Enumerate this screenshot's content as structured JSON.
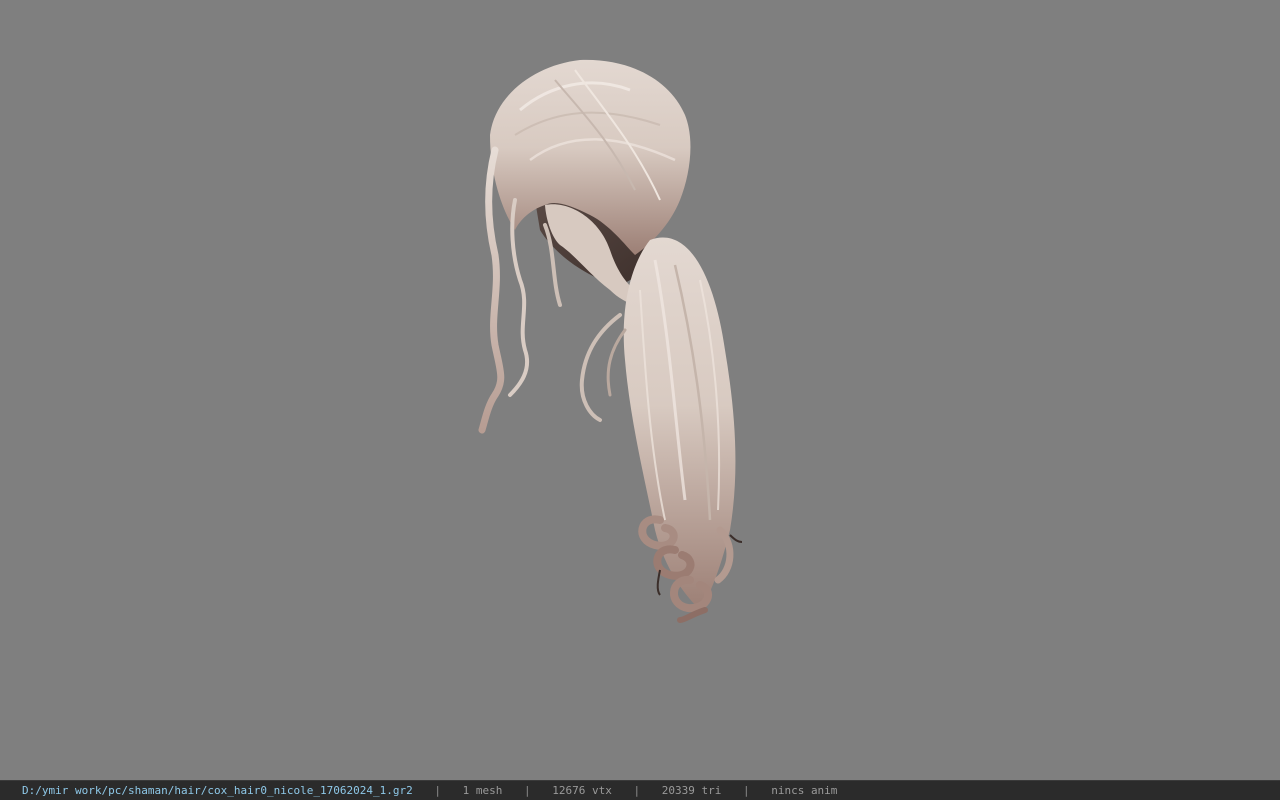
{
  "viewer": {
    "background_color": "#7f7f7f",
    "model_icon": "hair-model"
  },
  "status": {
    "file_path": "D:/ymir work/pc/shaman/hair/cox_hair0_nicole_17062024_1.gr2",
    "separator": "|",
    "mesh_count": "1 mesh",
    "vertex_count": "12676 vtx",
    "triangle_count": "20339 tri",
    "anim_status": "nincs anim"
  },
  "colors": {
    "status_bar_bg": "#2b2b2b",
    "path_text": "#8ec8e8",
    "stat_text": "#9a9a9a"
  }
}
